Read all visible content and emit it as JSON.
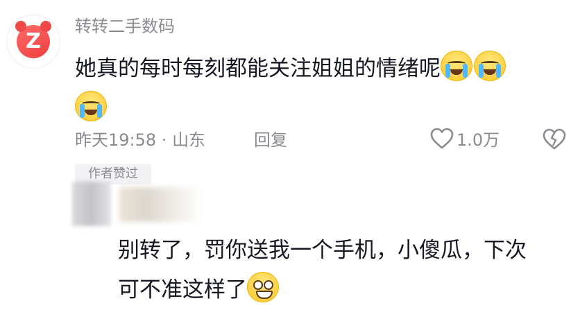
{
  "comment": {
    "username": "转转二手数码",
    "text": "她真的每时每刻都能关注姐姐的情绪呢",
    "emoji": "loudly-crying-face-icon",
    "time": "昨天19:58",
    "separator": " · ",
    "location": "山东",
    "reply_label": "回复",
    "like_count": "1.0万",
    "author_liked_tag": "作者赞过"
  },
  "reply": {
    "text_line1": "别转了，罚你送我一个手机，小傻瓜，下次",
    "text_line2": "可不准这样了",
    "emoji": "grinning-face-icon"
  },
  "colors": {
    "text_primary": "#161823",
    "text_secondary": "#8a8b91",
    "avatar_red": "#ef3e3e"
  }
}
